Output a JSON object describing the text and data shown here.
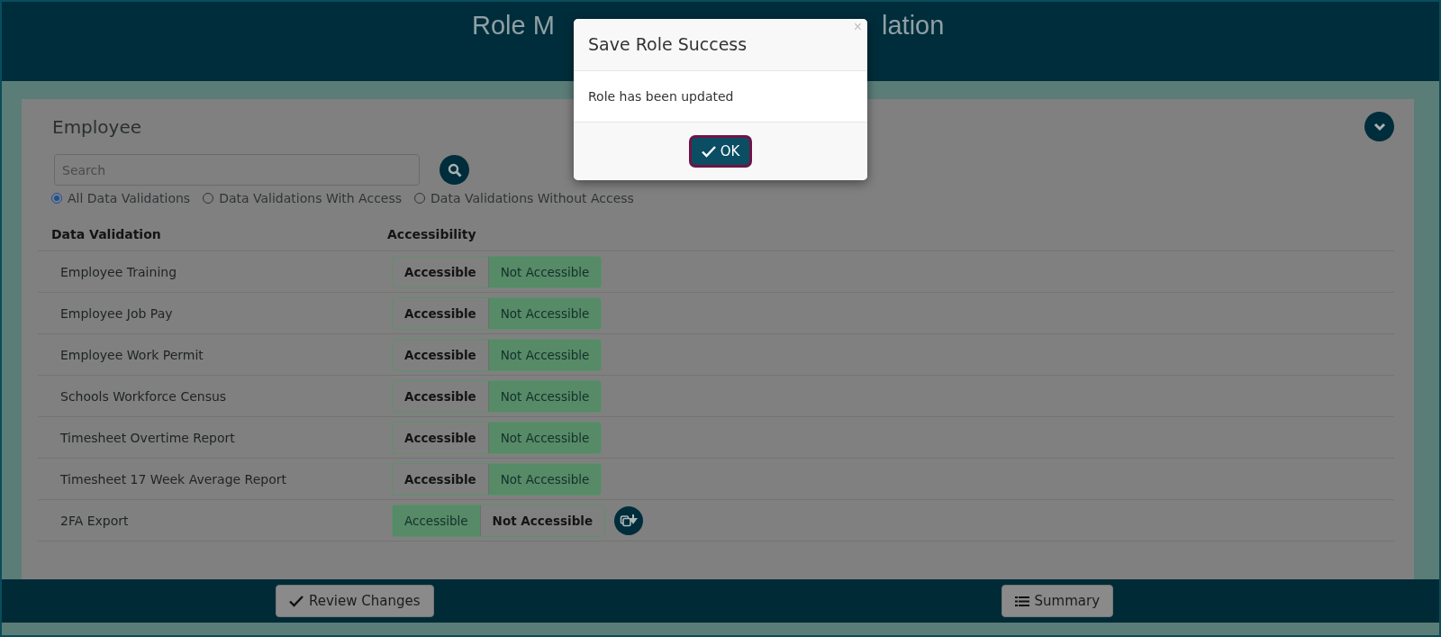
{
  "header": {
    "title_left": "Role M",
    "title_right": "lation"
  },
  "panel": {
    "title": "Employee",
    "search": {
      "placeholder": "Search"
    },
    "filters": [
      {
        "label": "All Data Validations",
        "selected": true
      },
      {
        "label": "Data Validations With Access",
        "selected": false
      },
      {
        "label": "Data Validations Without Access",
        "selected": false
      }
    ],
    "columns": [
      "Data Validation",
      "Accessibility"
    ],
    "rows": [
      {
        "name": "Employee Training",
        "options": [
          {
            "label": "Accessible",
            "selected": false
          },
          {
            "label": "Not Accessible",
            "selected": true
          }
        ],
        "action_icon": false
      },
      {
        "name": "Employee Job Pay",
        "options": [
          {
            "label": "Accessible",
            "selected": false
          },
          {
            "label": "Not Accessible",
            "selected": true
          }
        ],
        "action_icon": false
      },
      {
        "name": "Employee Work Permit",
        "options": [
          {
            "label": "Accessible",
            "selected": false
          },
          {
            "label": "Not Accessible",
            "selected": true
          }
        ],
        "action_icon": false
      },
      {
        "name": "Schools Workforce Census",
        "options": [
          {
            "label": "Accessible",
            "selected": false
          },
          {
            "label": "Not Accessible",
            "selected": true
          }
        ],
        "action_icon": false
      },
      {
        "name": "Timesheet Overtime Report",
        "options": [
          {
            "label": "Accessible",
            "selected": false
          },
          {
            "label": "Not Accessible",
            "selected": true
          }
        ],
        "action_icon": false
      },
      {
        "name": "Timesheet 17 Week Average Report",
        "options": [
          {
            "label": "Accessible",
            "selected": false
          },
          {
            "label": "Not Accessible",
            "selected": true
          }
        ],
        "action_icon": false
      },
      {
        "name": "2FA Export",
        "options": [
          {
            "label": "Accessible",
            "selected": true
          },
          {
            "label": "Not Accessible",
            "selected": false
          }
        ],
        "action_icon": true
      }
    ]
  },
  "footer": {
    "buttons": [
      {
        "label": "Review Changes"
      },
      {
        "label": "Summary"
      }
    ]
  },
  "dialog": {
    "title": "Save Role Success",
    "close": "×",
    "message": "Role has been updated",
    "ok": "OK"
  }
}
